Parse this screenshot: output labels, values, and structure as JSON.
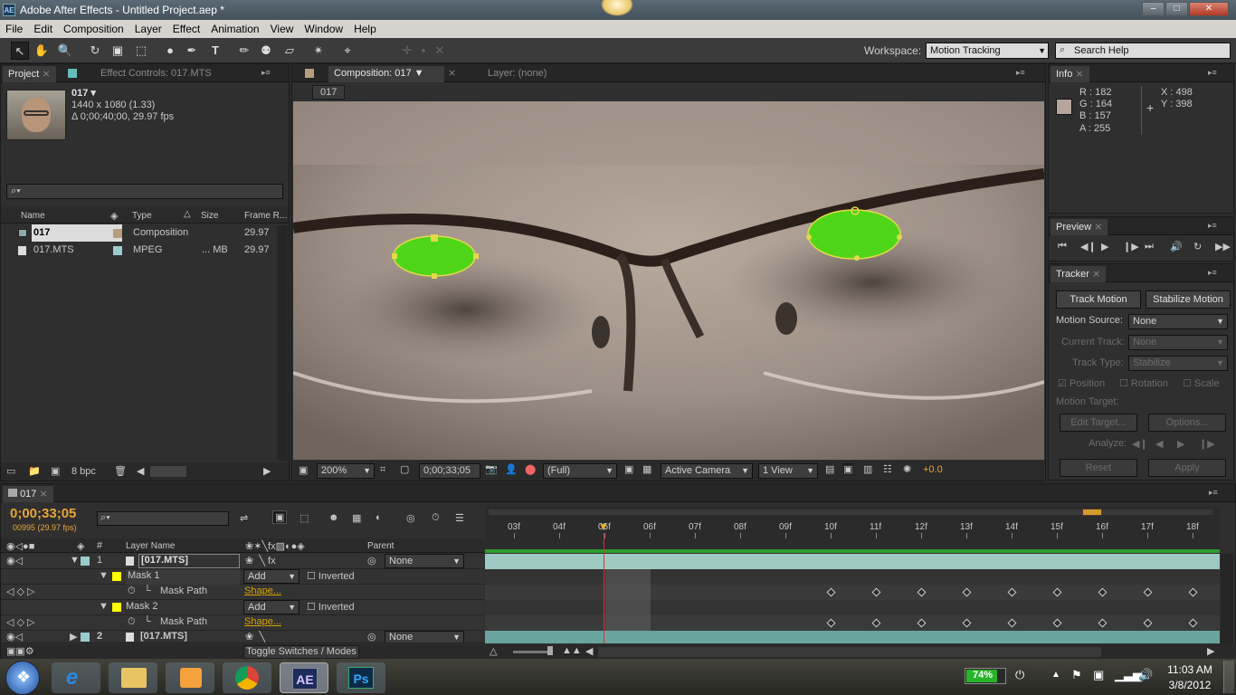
{
  "window": {
    "title": "Adobe After Effects - Untitled Project.aep *",
    "app_icon": "AE",
    "min": "–",
    "max": "□",
    "close": "✕"
  },
  "menu": [
    "File",
    "Edit",
    "Composition",
    "Layer",
    "Effect",
    "Animation",
    "View",
    "Window",
    "Help"
  ],
  "toolbar": {
    "workspace_label": "Workspace:",
    "workspace_value": "Motion Tracking",
    "search_placeholder": "Search Help"
  },
  "project": {
    "tab": "Project",
    "tab2": "Effect Controls: 017.MTS",
    "item_name": "017 ▾",
    "item_dims": "1440 x 1080 (1.33)",
    "item_duration": "Δ 0;00;40;00, 29.97 fps",
    "search_placeholder": "",
    "columns": [
      "Name",
      "Type",
      "Size",
      "Frame R..."
    ],
    "rows": [
      {
        "name": "017",
        "type": "Composition",
        "size": "",
        "fps": "29.97"
      },
      {
        "name": "017.MTS",
        "type": "MPEG",
        "size": "... MB",
        "fps": "29.97"
      }
    ],
    "bpc": "8 bpc"
  },
  "composition": {
    "tab": "Composition: 017",
    "layer_tab": "Layer: (none)",
    "breadcrumb": "017",
    "zoom": "200%",
    "timecode": "0;00;33;05",
    "resolution": "(Full)",
    "camera": "Active Camera",
    "view": "1 View",
    "exposure": "+0.0"
  },
  "info": {
    "tab": "Info",
    "r": "R : 182",
    "g": "G : 164",
    "b": "B : 157",
    "a": "A : 255",
    "x": "X : 498",
    "y": "Y : 398",
    "swatch": "#b6a49d"
  },
  "preview": {
    "tab": "Preview"
  },
  "tracker": {
    "tab": "Tracker",
    "track_motion": "Track Motion",
    "stabilize_motion": "Stabilize Motion",
    "motion_source_label": "Motion Source:",
    "motion_source_value": "None",
    "current_track_label": "Current Track:",
    "current_track_value": "None",
    "track_type_label": "Track Type:",
    "track_type_value": "Stabilize",
    "position": "Position",
    "rotation": "Rotation",
    "scale": "Scale",
    "motion_target_label": "Motion Target:",
    "edit_target": "Edit Target...",
    "options": "Options...",
    "analyze_label": "Analyze:",
    "reset": "Reset",
    "apply": "Apply"
  },
  "timeline": {
    "tab": "017",
    "timecode": "0;00;33;05",
    "frame_info": "00995 (29.97 fps)",
    "search_placeholder": "",
    "col_layer_name": "Layer Name",
    "col_parent": "Parent",
    "ruler": [
      "03f",
      "04f",
      "05f",
      "06f",
      "07f",
      "08f",
      "09f",
      "10f",
      "11f",
      "12f",
      "13f",
      "14f",
      "15f",
      "16f",
      "17f",
      "18f"
    ],
    "layers": [
      {
        "num": "1",
        "name": "[017.MTS]",
        "parent": "None"
      },
      {
        "num": "2",
        "name": "[017.MTS]",
        "parent": "None"
      }
    ],
    "mask1": {
      "name": "Mask 1",
      "mode": "Add",
      "inverted": "Inverted",
      "path": "Mask Path",
      "shape": "Shape..."
    },
    "mask2": {
      "name": "Mask 2",
      "mode": "Add",
      "inverted": "Inverted",
      "path": "Mask Path",
      "shape": "Shape..."
    },
    "toggle": "Toggle Switches / Modes"
  },
  "taskbar": {
    "battery": "74%",
    "time": "11:03 AM",
    "date": "3/8/2012",
    "ps": "Ps",
    "ae": "AE"
  }
}
